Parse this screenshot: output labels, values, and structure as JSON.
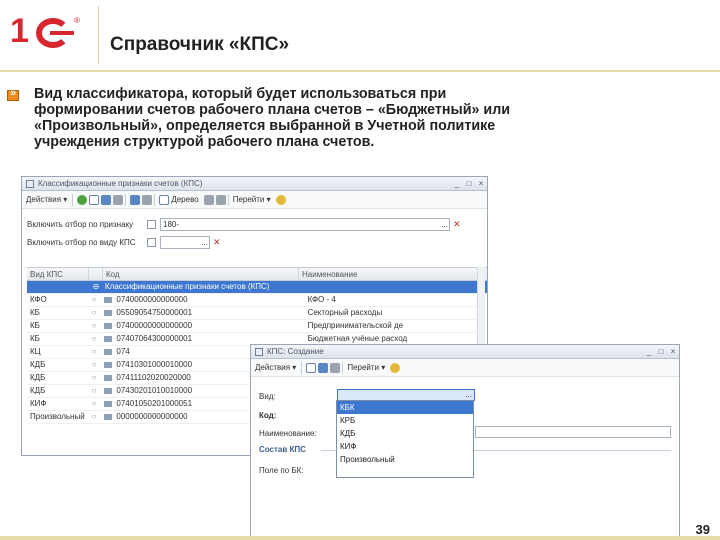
{
  "slide": {
    "title": "Справочник «КПС»",
    "page_number": "39",
    "body_text": "Вид классификатора, который будет использоваться при формировании счетов рабочего плана счетов – «Бюджетный» или «Произвольный», определяется выбранной в Учетной политике учреждения структурой рабочего плана счетов."
  },
  "main_window": {
    "title": "Классификационные признаки счетов (КПС)",
    "toolbar": {
      "actions_label": "Действия",
      "tree_label": "Дерево",
      "goto_label": "Перейти"
    },
    "filters": [
      {
        "label": "Включить отбор по признаку",
        "value": "180-"
      },
      {
        "label": "Включить отбор по виду КПС",
        "value": ""
      }
    ],
    "columns": [
      "Вид КПС",
      "Код",
      "Наименование"
    ],
    "group_row": "Классификационные признаки счетов (КПС)",
    "rows": [
      {
        "kind": "КФО",
        "code": "0740000000000000",
        "name": "КФО - 4"
      },
      {
        "kind": "КБ",
        "code": "05509054750000001",
        "name": "Секторный расходы"
      },
      {
        "kind": "КБ",
        "code": "07400000000000000",
        "name": "Предпринимательской де"
      },
      {
        "kind": "КБ",
        "code": "07407064300000001",
        "name": "Бюджетная учёные расход"
      },
      {
        "kind": "КЦ",
        "code": "074",
        "name": ""
      },
      {
        "kind": "КДБ",
        "code": "07410301000010000",
        "name": ""
      },
      {
        "kind": "КДБ",
        "code": "07411102020020000",
        "name": ""
      },
      {
        "kind": "КДБ",
        "code": "07430201010010000",
        "name": ""
      },
      {
        "kind": "КИФ",
        "code": "07401050201000051",
        "name": ""
      },
      {
        "kind": "Произвольный",
        "code": "0000000000000000",
        "name": ""
      }
    ]
  },
  "create_window": {
    "title": "КПС: Создание",
    "toolbar": {
      "actions_label": "Действия",
      "goto_label": "Перейти"
    },
    "fields": {
      "kind_label": "Вид:",
      "code_label": "Код:",
      "name_label": "Наименование:",
      "section_label": "Состав КПС",
      "bk_label": "Поле по БК:"
    },
    "dropdown_options": [
      "КБК",
      "КРБ",
      "КДБ",
      "КИФ",
      "Произвольный"
    ],
    "dropdown_selected_index": 0
  },
  "colors": {
    "accent": "#d8262e",
    "bullet": "#ed8b1f",
    "selection": "#3d77cf",
    "rule": "#e6dca8"
  },
  "icons": {
    "logo": "1c-logo",
    "bullet": "bullet-arrow-icon",
    "window_close": "close-icon",
    "window_min": "minimize-icon",
    "window_max": "maximize-icon",
    "help": "help-icon"
  }
}
